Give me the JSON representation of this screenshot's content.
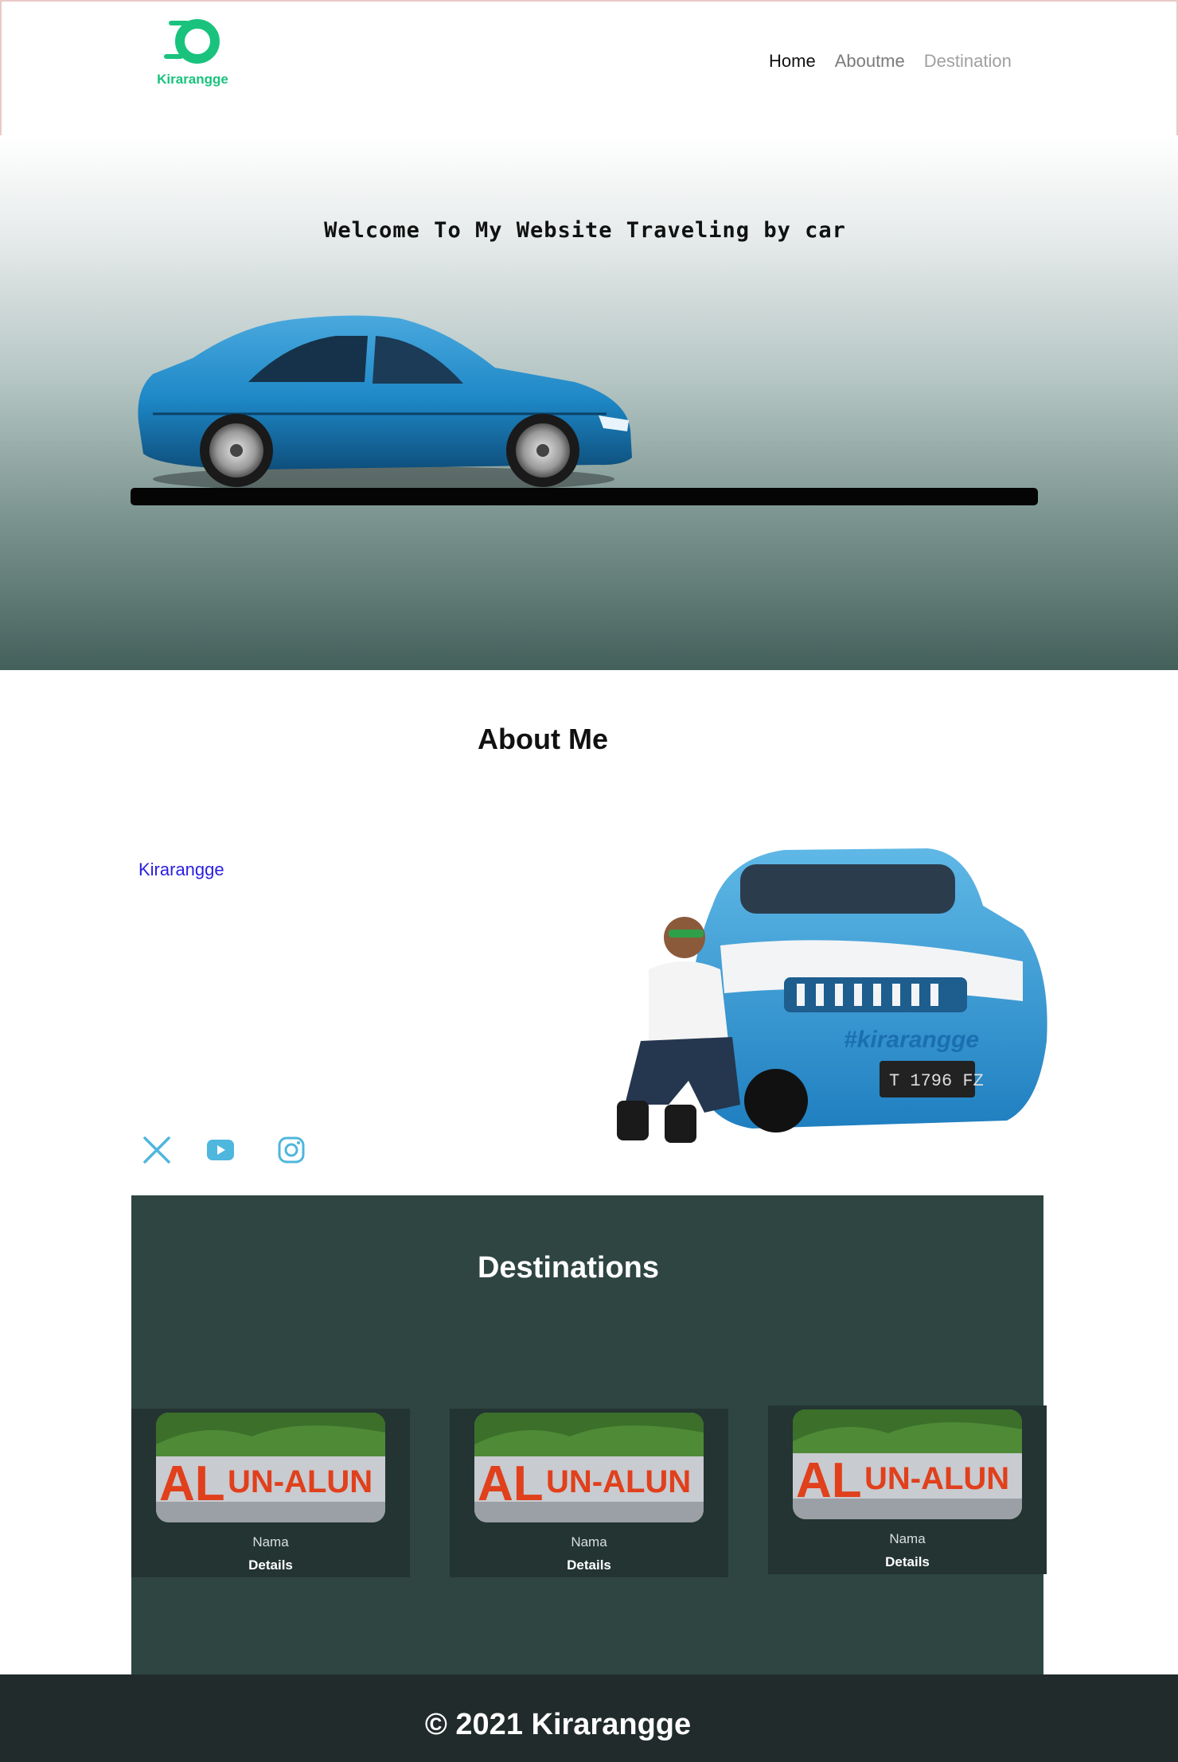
{
  "header": {
    "logo_text": "Kirarangge",
    "nav": [
      {
        "label": "Home"
      },
      {
        "label": "Aboutme"
      },
      {
        "label": "Destination"
      }
    ]
  },
  "hero": {
    "title": "Welcome To My Website Traveling by car",
    "car_color": "#1d87c6"
  },
  "about": {
    "title": "About Me",
    "name": "Kirarangge",
    "social": [
      {
        "icon": "x-twitter-icon"
      },
      {
        "icon": "youtube-icon"
      },
      {
        "icon": "instagram-icon"
      }
    ]
  },
  "destinations": {
    "title": "Destinations",
    "cards": [
      {
        "name": "Nama",
        "details": "Details"
      },
      {
        "name": "Nama",
        "details": "Details"
      },
      {
        "name": "Nama",
        "details": "Details"
      }
    ]
  },
  "footer": {
    "text": "© 2021 Kirarangge"
  },
  "colors": {
    "brand_green": "#19c37d",
    "accent_blue": "#4fb6de",
    "link_blue": "#2a1ee0",
    "destinations_bg": "#2f4542",
    "card_bg": "#233432",
    "footer_bg": "#212b2b"
  }
}
